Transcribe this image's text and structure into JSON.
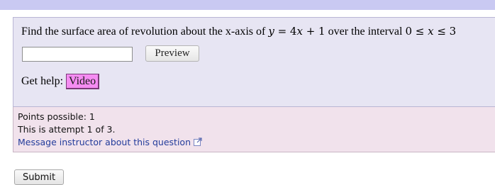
{
  "question": {
    "prefix": "Find the surface area of revolution about the x-axis of ",
    "math_y": "y",
    "math_eq": " = 4",
    "math_x": "x",
    "math_plus": " + 1",
    "middle": " over the interval ",
    "interval_left": "0 ≤ ",
    "interval_var": "x",
    "interval_right": " ≤ 3"
  },
  "answer": {
    "value": "",
    "placeholder": ""
  },
  "preview_label": "Preview",
  "help": {
    "label": "Get help:",
    "video_label": "Video"
  },
  "info": {
    "points": "Points possible: 1",
    "attempt": "This is attempt 1 of 3.",
    "message_link": "Message instructor about this question",
    "link_icon": "external-link-icon"
  },
  "submit_label": "Submit",
  "colors": {
    "top_bar": "#c9c9f2",
    "question_bg": "#e7e5f3",
    "info_bg": "#f1e2ec",
    "video_bg": "#f58cf2",
    "link": "#233c9b"
  }
}
